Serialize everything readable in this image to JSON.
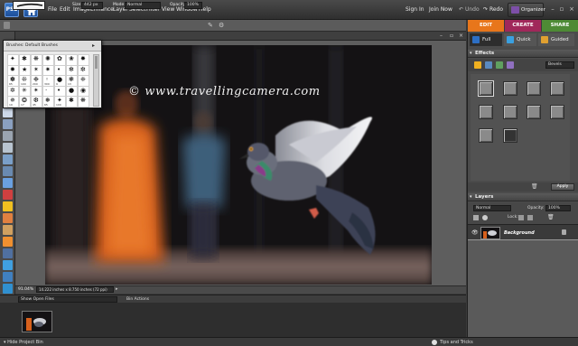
{
  "app": {
    "logo": "PSE"
  },
  "menu": [
    "File",
    "Edit",
    "Image",
    "Enhance",
    "Layer",
    "Select",
    "Filter",
    "View",
    "Window",
    "Help"
  ],
  "top_links": {
    "sign_in": "Sign In",
    "join_now": "Join Now",
    "undo": "Undo",
    "redo": "Redo",
    "organizer": "Organizer"
  },
  "options_bar": {
    "size_label": "Size:",
    "size_value": "442 px",
    "mode_label": "Mode:",
    "mode_value": "Normal",
    "opacity_label": "Opacity:",
    "opacity_value": "100%"
  },
  "mode_tabs": [
    {
      "label": "EDIT",
      "color": "#e8761b"
    },
    {
      "label": "CREATE",
      "color": "#d1236a"
    },
    {
      "label": "SHARE",
      "color": "#57a63b"
    }
  ],
  "edit_subtabs": [
    "Full",
    "Quick",
    "Guided"
  ],
  "brushes_popup": {
    "label": "Brushes:",
    "set": "Default Brushes",
    "sizes_row3": [
      "65",
      "100",
      "200",
      "300",
      "9",
      "13"
    ],
    "sizes_row5": [
      "19",
      "17",
      "45",
      "65",
      "100"
    ]
  },
  "document": {
    "watermark": "© www.travellingcamera.com",
    "zoom": "91.04%",
    "dimensions": "14.222 inches x 8.750 inches (72 ppi)"
  },
  "effects_panel": {
    "title": "Effects",
    "category": "Bevels",
    "apply": "Apply"
  },
  "layers_panel": {
    "title": "Layers",
    "blend_mode": "Normal",
    "opacity_label": "Opacity:",
    "opacity_value": "100%",
    "lock_label": "Lock:",
    "layer_name": "Background"
  },
  "project_bin": {
    "show_label": "Show Open Files",
    "actions_label": "Bin Actions"
  },
  "bottom": {
    "hide_bin": "Hide Project Bin",
    "tips": "Tips and Tricks"
  },
  "colors": {
    "accent_blue": "#2d6fc4",
    "panel_bg": "#4b4b4b",
    "edit_orange": "#e8761b"
  }
}
